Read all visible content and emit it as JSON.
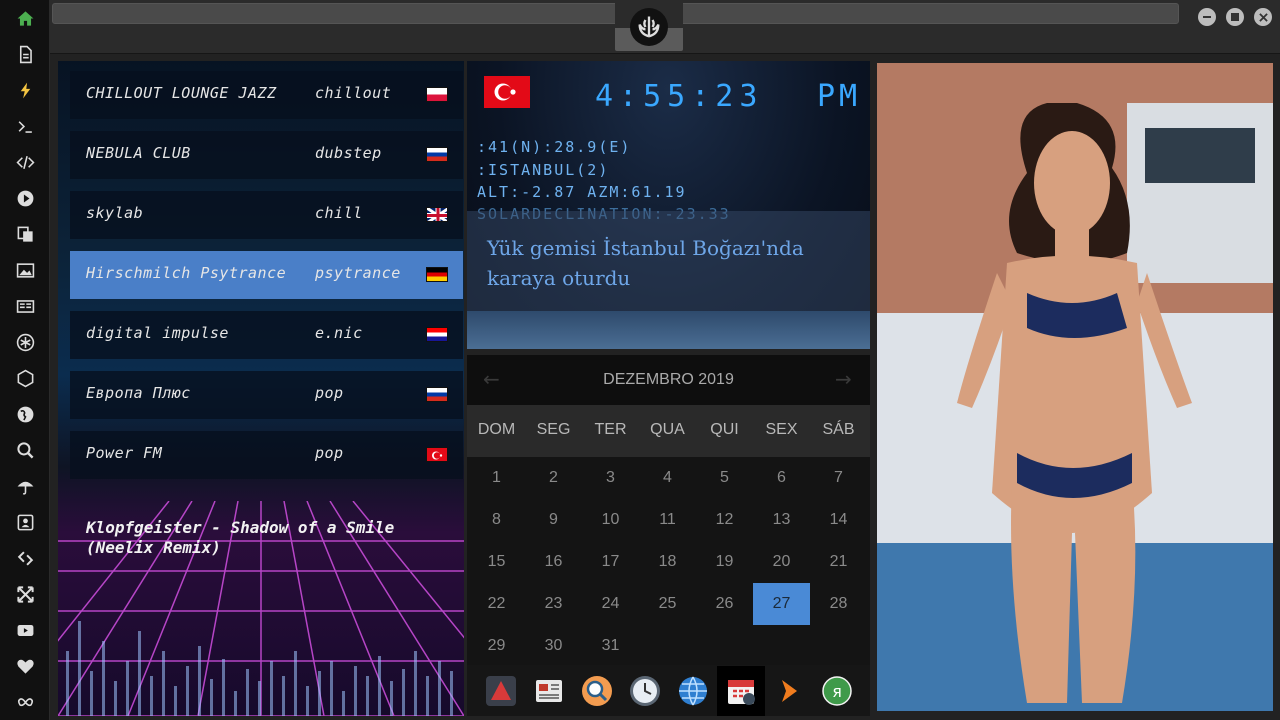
{
  "radio": {
    "stations": [
      {
        "name": "CHILLOUT LOUNGE JAZZ",
        "genre": "chillout",
        "flag": "poland"
      },
      {
        "name": "NEBULA CLUB",
        "genre": "dubstep",
        "flag": "russia"
      },
      {
        "name": "skylab",
        "genre": "chill",
        "flag": "united-kingdom"
      },
      {
        "name": "Hirschmilch Psytrance",
        "genre": "psytrance",
        "flag": "germany"
      },
      {
        "name": "digital impulse",
        "genre": "e.nic",
        "flag": "croatia"
      },
      {
        "name": "Европа Плюс",
        "genre": "pop",
        "flag": "russia"
      },
      {
        "name": "Power FM",
        "genre": "pop",
        "flag": "turkey"
      }
    ],
    "now_playing": "Klopfgeister - Shadow of a Smile (Neelix Remix)"
  },
  "clock": {
    "time": "4:55:23",
    "ampm": "PM",
    "coords": ":41(N):28.9(E)",
    "city": ":ISTANBUL(2)",
    "alt_azm": "ALT:-2.87 AZM:61.19",
    "solar": "SOLARDECLINATION:-23.33",
    "news": "Yük gemisi İstanbul Boğazı'nda karaya oturdu",
    "flag": "turkey"
  },
  "calendar": {
    "title": "DEZEMBRO 2019",
    "prev": "←",
    "next": "→",
    "weekdays": [
      "DOM",
      "SEG",
      "TER",
      "QUA",
      "QUI",
      "SEX",
      "SÁB"
    ],
    "days": [
      "1",
      "2",
      "3",
      "4",
      "5",
      "6",
      "7",
      "8",
      "9",
      "10",
      "11",
      "12",
      "13",
      "14",
      "15",
      "16",
      "17",
      "18",
      "19",
      "20",
      "21",
      "22",
      "23",
      "24",
      "25",
      "26",
      "27",
      "28",
      "29",
      "30",
      "31"
    ],
    "today": "27"
  },
  "colors": {
    "accent": "#4a8ad6",
    "clock_text": "#3aa8ff",
    "home_icon": "#4caf50",
    "bolt_icon": "#f4c542",
    "active_station": "#4a7fc8"
  }
}
